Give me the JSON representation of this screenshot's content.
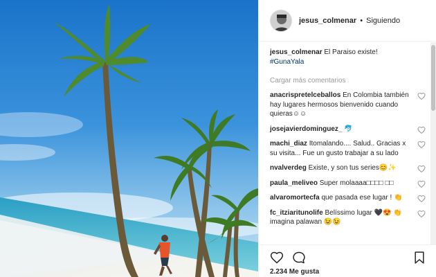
{
  "post": {
    "username": "jesus_colmenar",
    "separator": "•",
    "follow_status": "Siguiendo",
    "caption_text": "El Paraiso existe!",
    "hashtag": "#GunaYala",
    "load_more": "Cargar más comentarios",
    "likes": "2.234 Me gusta"
  },
  "comments": [
    {
      "user": "anacrispretelceballos",
      "text": "En Colombia también hay lugares hermosos bienvenido cuando quieras☺☺"
    },
    {
      "user": "josejavierdominguez_",
      "text": "🐬"
    },
    {
      "user": "machi_diaz",
      "text": "Itomalando.... Salud.. Gracias x su visita... Fue un gusto trabajar a su lado"
    },
    {
      "user": "nvalverdeg",
      "text": "Existe, y son tus series😊✨"
    },
    {
      "user": "paula_meliveo",
      "text": "Super molaaaa□□□□ □□"
    },
    {
      "user": "alvaromortecfa",
      "text": "que pasada ese lugar ! 👏"
    },
    {
      "user": "fc_itziaritunolife",
      "text": "Belíssimo lugar 🖤😍 👏 imagina palawan 😉😉"
    }
  ],
  "icons": {
    "like": "heart-outline-icon",
    "comment": "comment-bubble-icon",
    "save": "bookmark-icon",
    "comment_like": "small-heart-icon"
  },
  "colors": {
    "text": "#262626",
    "muted": "#999999",
    "link": "#003569",
    "border": "#efefef"
  }
}
